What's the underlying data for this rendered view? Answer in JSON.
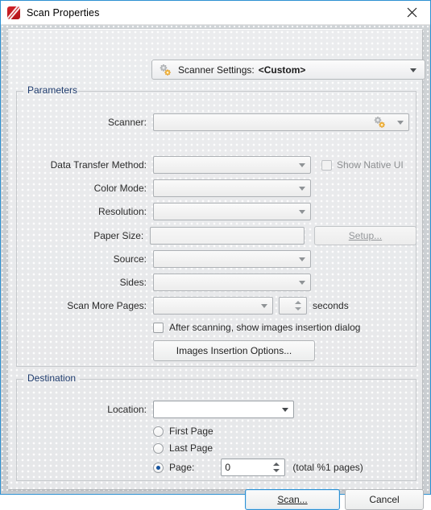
{
  "window": {
    "title": "Scan Properties",
    "icon": "pdf-xchange-logo-icon",
    "close_label": "✕",
    "accent": "#2e91d2"
  },
  "scanner_settings_bar": {
    "icon": "gears-icon",
    "label": "Scanner Settings:",
    "value": "<Custom>",
    "dropdown_icon": "chevron-down-icon"
  },
  "parameters": {
    "group_title": "Parameters",
    "scanner": {
      "label": "Scanner:",
      "value": "",
      "icon": "gears-icon",
      "dropdown_icon": "chevron-down-icon"
    },
    "data_transfer_method": {
      "label": "Data Transfer Method:",
      "value": "",
      "disabled": true
    },
    "show_native_ui": {
      "label": "Show Native UI",
      "checked": false,
      "disabled": true
    },
    "color_mode": {
      "label": "Color Mode:",
      "value": "",
      "disabled": true
    },
    "resolution": {
      "label": "Resolution:",
      "value": "",
      "disabled": true
    },
    "paper_size": {
      "label": "Paper Size:",
      "value": "",
      "disabled": true
    },
    "setup_button": {
      "label": "Setup...",
      "accesskey": "S",
      "disabled": true
    },
    "source": {
      "label": "Source:",
      "value": "",
      "disabled": true
    },
    "sides": {
      "label": "Sides:",
      "value": "",
      "disabled": true
    },
    "scan_more_pages": {
      "label": "Scan More Pages:",
      "value": "",
      "spinner_value": "",
      "units": "seconds",
      "disabled": true
    },
    "after_scanning": {
      "label": "After scanning, show images insertion dialog",
      "checked": false
    },
    "images_insertion_options": {
      "label": "Images Insertion Options..."
    }
  },
  "destination": {
    "group_title": "Destination",
    "location": {
      "label": "Location:",
      "value": "",
      "dropdown_icon": "chevron-down-icon"
    },
    "radios": [
      {
        "label": "First Page",
        "selected": false
      },
      {
        "label": "Last Page",
        "selected": false
      },
      {
        "label": "Page:",
        "selected": true
      }
    ],
    "page_number": "0",
    "total_pages_text": "(total %1 pages)"
  },
  "footer": {
    "scan_button": {
      "label": "Scan...",
      "accesskey": "S",
      "is_default": true
    },
    "cancel_button": {
      "label": "Cancel",
      "accesskey": "C"
    }
  }
}
